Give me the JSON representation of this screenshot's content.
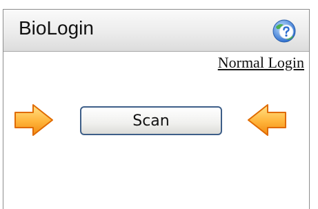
{
  "header": {
    "title": "BioLogin"
  },
  "links": {
    "normal_login": "Normal Login"
  },
  "buttons": {
    "scan_label": "Scan"
  },
  "icons": {
    "help": "help-globe-icon",
    "left_arrow": "arrow-right-icon",
    "right_arrow": "arrow-left-icon"
  },
  "colors": {
    "arrow_fill": "#ffb43a",
    "arrow_edge": "#e06a00",
    "button_border": "#3d5e88",
    "help_blue": "#3b7fd8"
  }
}
